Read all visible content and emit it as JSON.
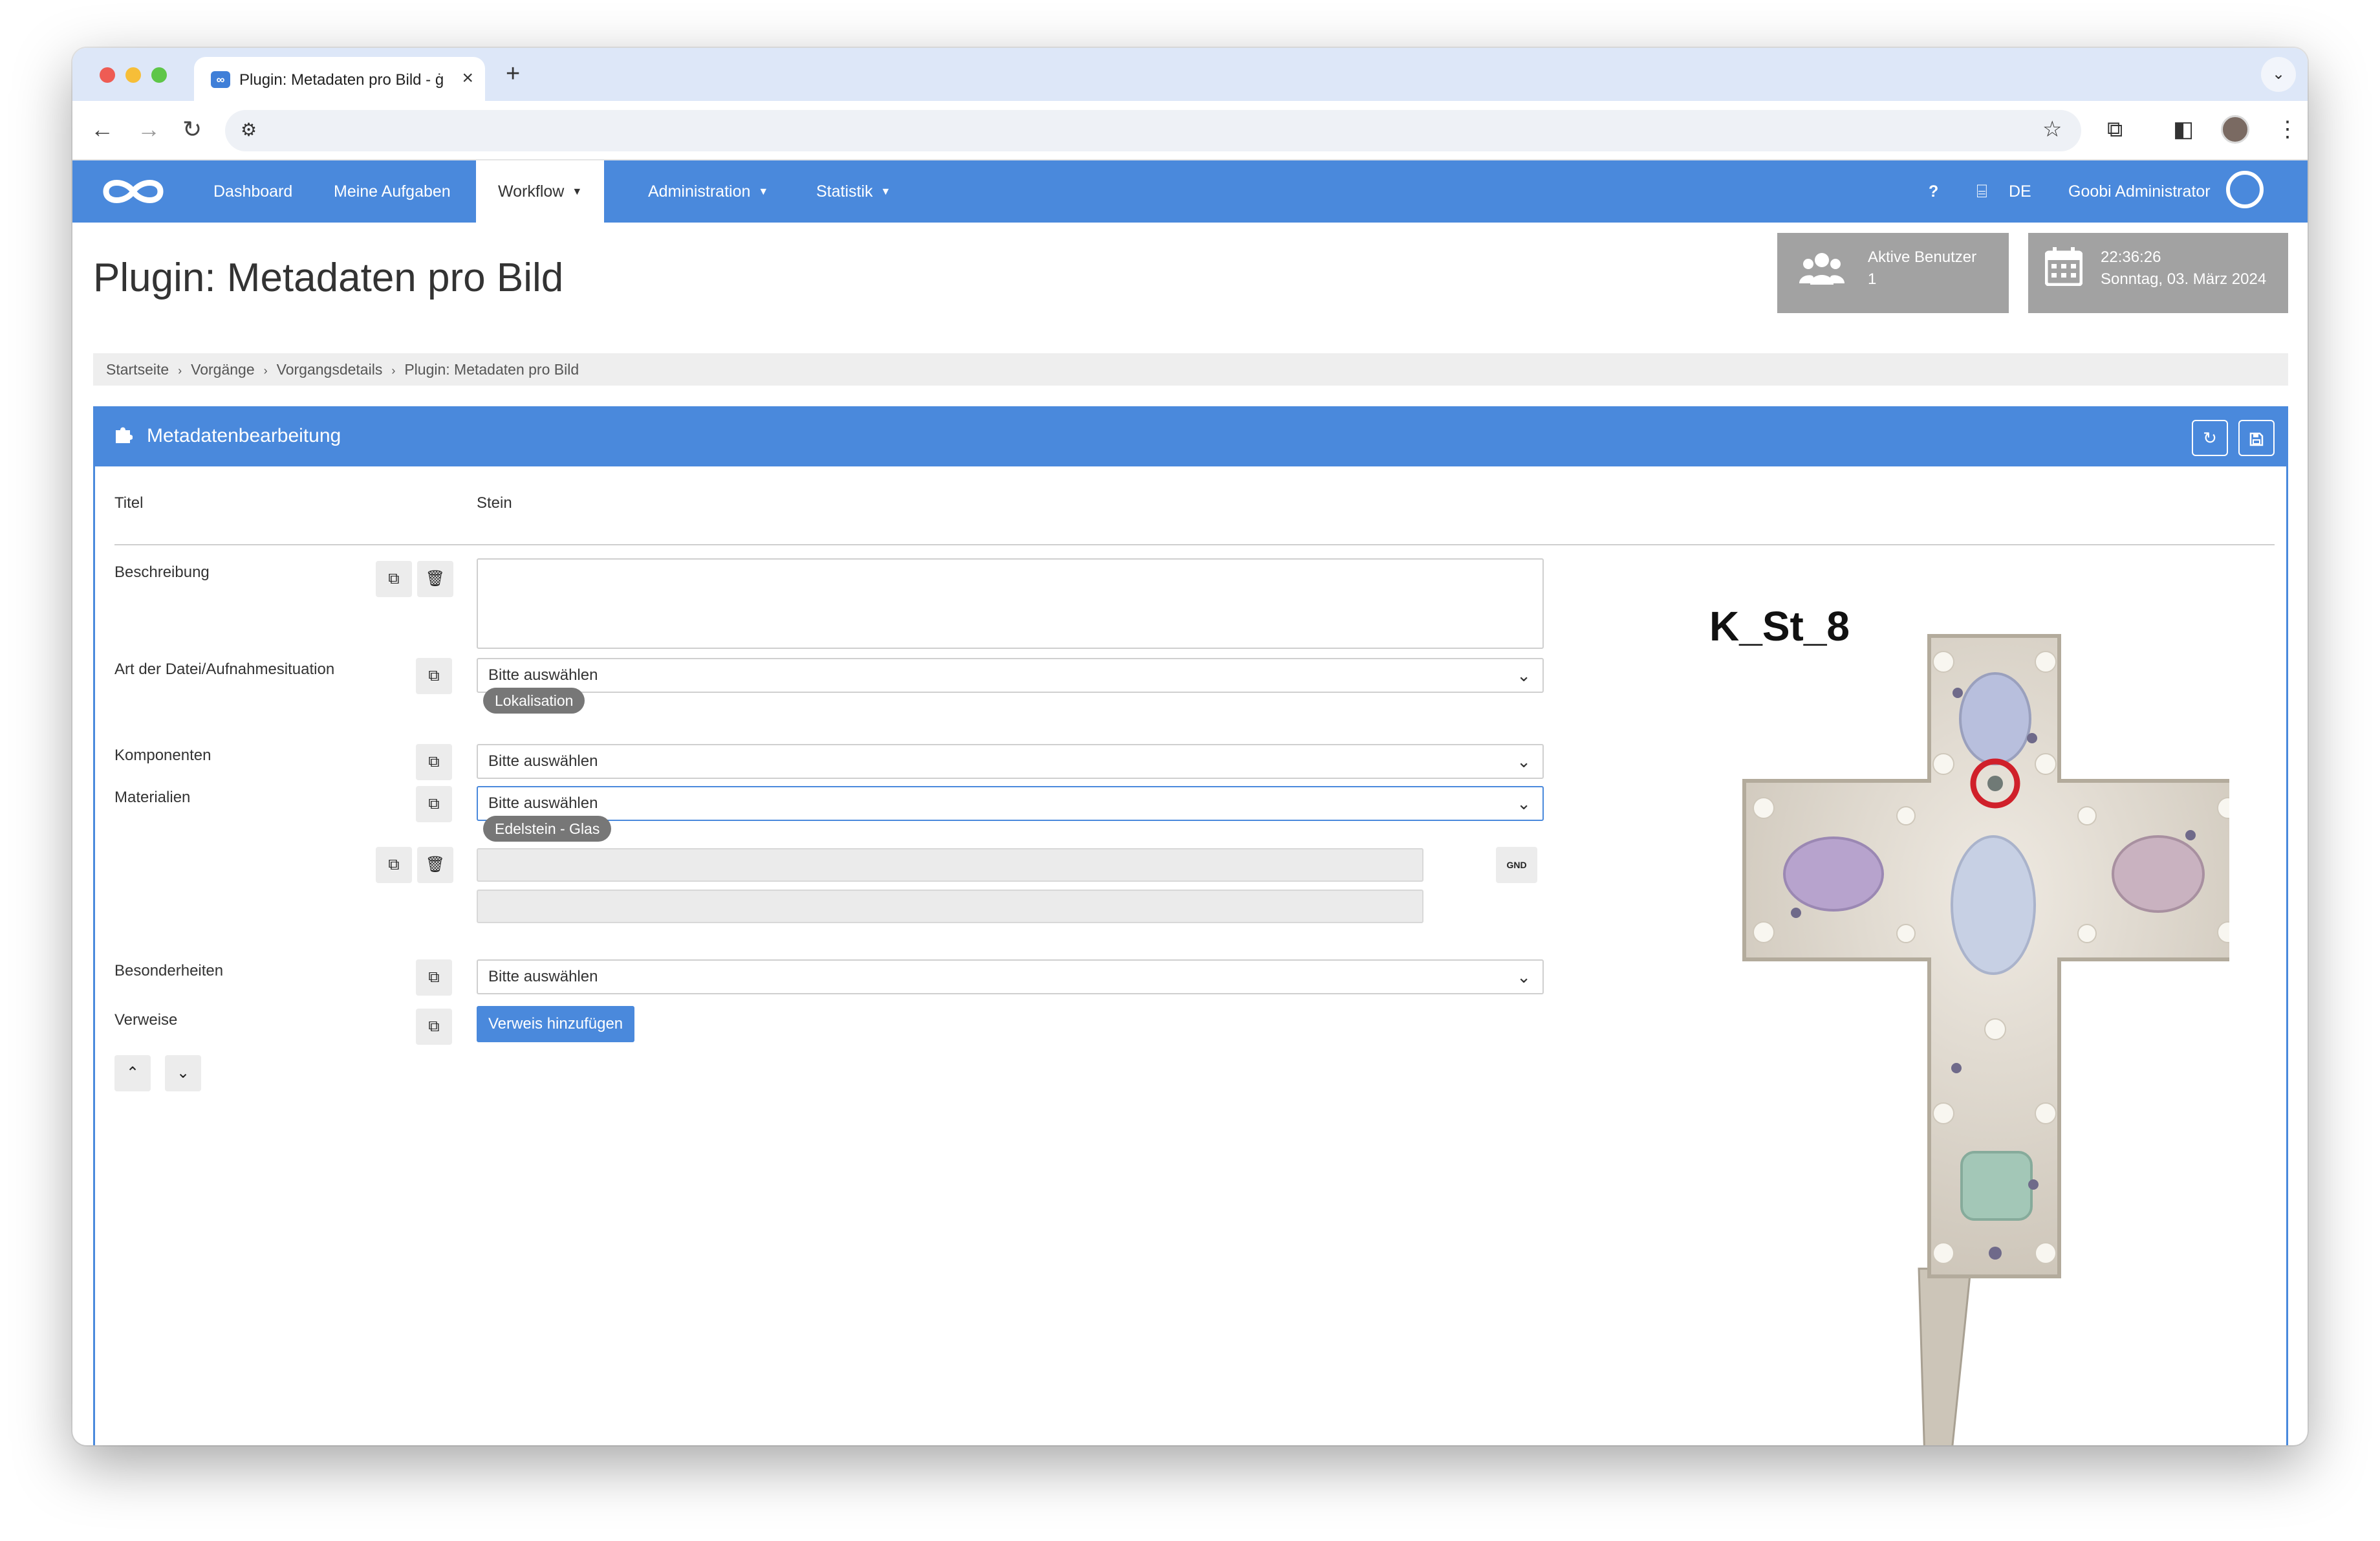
{
  "browser": {
    "tab_title": "Plugin: Metadaten pro Bild - ġ",
    "tab_close": "×",
    "new_tab": "+",
    "tab_menu": "⌄"
  },
  "navbar": {
    "items": [
      {
        "label": "Dashboard"
      },
      {
        "label": "Meine Aufgaben"
      },
      {
        "label": "Workflow"
      },
      {
        "label": "Administration"
      },
      {
        "label": "Statistik"
      }
    ],
    "help": "?",
    "language": "DE",
    "user": "Goobi Administrator"
  },
  "header": {
    "title": "Plugin: Metadaten pro Bild",
    "active_users_label": "Aktive Benutzer",
    "active_users_count": "1",
    "time": "22:36:26",
    "date": "Sonntag, 03. März 2024"
  },
  "breadcrumb": [
    "Startseite",
    "Vorgänge",
    "Vorgangsdetails",
    "Plugin: Metadaten pro Bild"
  ],
  "panel": {
    "title": "Metadatenbearbeitung",
    "titel_label": "Titel",
    "titel_value": "Stein",
    "beschreibung_label": "Beschreibung",
    "art_label": "Art der Datei/Aufnahmesituation",
    "art_value": "Bitte auswählen",
    "lokalisation_badge": "Lokalisation",
    "komponenten_label": "Komponenten",
    "komponenten_value": "Bitte auswählen",
    "materialien_label": "Materialien",
    "materialien_value": "Bitte auswählen",
    "edelstein_badge": "Edelstein - Glas",
    "gnd_label": "GND",
    "besonderheiten_label": "Besonderheiten",
    "besonderheiten_value": "Bitte auswählen",
    "verweise_label": "Verweise",
    "verweis_button": "Verweis hinzufügen"
  },
  "image": {
    "caption": "K_St_8"
  },
  "colors": {
    "accent": "#4a89dc",
    "info_box": "#a2a2a2",
    "badge": "#777777",
    "marker": "#d0202a"
  }
}
